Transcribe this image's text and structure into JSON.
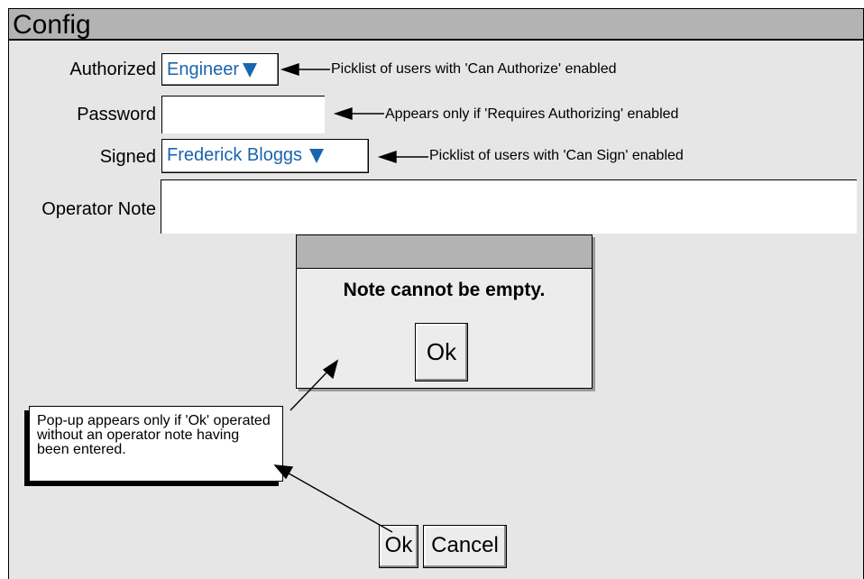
{
  "window": {
    "title": "Config"
  },
  "form": {
    "authorized": {
      "label": "Authorized",
      "value": "Engineer"
    },
    "password": {
      "label": "Password",
      "value": ""
    },
    "signed": {
      "label": "Signed",
      "value": "Frederick Bloggs"
    },
    "operator_note": {
      "label": "Operator Note",
      "value": ""
    }
  },
  "annotations": {
    "authorized": "Picklist of users with 'Can Authorize' enabled",
    "password": "Appears only if 'Requires Authorizing' enabled",
    "signed": "Picklist of users with 'Can Sign' enabled",
    "popup": "Pop-up appears only if 'Ok' operated without an operator note having been entered."
  },
  "popup": {
    "message": "Note cannot be empty.",
    "ok_label": "Ok"
  },
  "footer": {
    "ok_label": "Ok",
    "cancel_label": "Cancel"
  },
  "colors": {
    "title_bar": "#b3b3b3",
    "background": "#e6e6e6",
    "picker_text": "#1a64b0",
    "button": "#ececec"
  }
}
